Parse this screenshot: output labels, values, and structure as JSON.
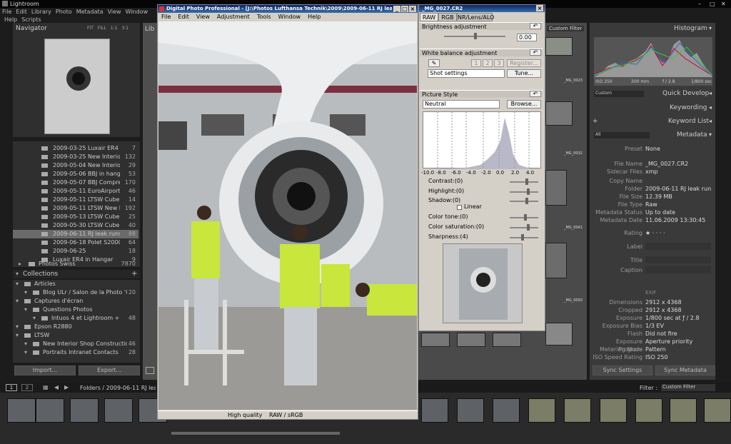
{
  "app_title": "Lightroom",
  "lr_menu": [
    "File",
    "Edit",
    "Library",
    "Photo",
    "Metadata",
    "View",
    "Window",
    "Help",
    "Scripts"
  ],
  "navigator": {
    "title": "Navigator",
    "zooms": [
      "FIT",
      "FILL",
      "1:1",
      "3:1"
    ]
  },
  "library_tab": "Lib",
  "folders": [
    {
      "name": "2009-03-25 Luxair ER4 test...",
      "count": "7"
    },
    {
      "name": "2009-03-25 New Interior S...",
      "count": "132"
    },
    {
      "name": "2009-05-04 New Interior S...",
      "count": "29"
    },
    {
      "name": "2009-05-06 BBJ in hangar",
      "count": "53"
    },
    {
      "name": "2009-05-07 BBJ Compress...",
      "count": "170"
    },
    {
      "name": "2009-05-11 EuroAirport By...",
      "count": "46"
    },
    {
      "name": "2009-05-11 LTSW Cube By ...",
      "count": "14"
    },
    {
      "name": "2009-05-11 LTSW New Inte...",
      "count": "192"
    },
    {
      "name": "2009-05-13 LTSW Cube By ...",
      "count": "25"
    },
    {
      "name": "2009-05-30 LTSW Cube By ...",
      "count": "40"
    },
    {
      "name": "2009-06-11 RJ leak runs",
      "count": "88"
    },
    {
      "name": "2009-06-18 Polet S2000 De...",
      "count": "64"
    },
    {
      "name": "2009-06-25",
      "count": "18"
    },
    {
      "name": "Luxair ER4 in Hangar",
      "count": "9"
    }
  ],
  "photos_swiss": {
    "name": "Photos Swiss",
    "count": "7870"
  },
  "collections": {
    "title": "Collections",
    "plus": "+"
  },
  "collection_items": [
    {
      "name": "Articles",
      "count": ""
    },
    {
      "name": "Blog ULr / Salon de la Photo '08",
      "count": "20"
    },
    {
      "name": "Captures d'écran",
      "count": ""
    },
    {
      "name": "Questions Photos",
      "count": ""
    },
    {
      "name": "Intuos 4 et Lightroom  +",
      "count": "48"
    },
    {
      "name": "Epson R2880",
      "count": ""
    },
    {
      "name": "LTSW",
      "count": ""
    },
    {
      "name": "New Interior Shop Construction",
      "count": "46"
    },
    {
      "name": "Portraits Intranet Contacts",
      "count": "28"
    }
  ],
  "import_label": "Import...",
  "export_label": "Export...",
  "dpp": {
    "title": "Digital Photo Professional - [J:\\Photos Lufthansa Technik\\2009\\2009-06-11 RJ leak runs\\...",
    "menu": [
      "File",
      "Edit",
      "View",
      "Adjustment",
      "Tools",
      "Window",
      "Help"
    ],
    "status_quality": "High quality",
    "status_mode": "RAW / sRGB"
  },
  "tool": {
    "title": "_MG_0027.CR2",
    "tabs": [
      "RAW",
      "RGB",
      "NR/Lens/ALO"
    ],
    "brightness_label": "Brightness adjustment",
    "brightness_value": "0.00",
    "wb_label": "White balance adjustment",
    "wb_register": "Register...",
    "wb_nums": [
      "1",
      "2",
      "3"
    ],
    "wb_select": "Shot settings",
    "wb_tune": "Tune...",
    "picture_style_label": "Picture Style",
    "picture_style_value": "Neutral",
    "browse": "Browse...",
    "hist_ticks": [
      "-10.0",
      "-8.0",
      "-6.0",
      "-4.0",
      "-2.0",
      "0.0",
      "2.0",
      "4.0"
    ],
    "contrast": "Contrast:(0)",
    "highlight": "Highlight:(0)",
    "shadow": "Shadow:(0)",
    "linear": "Linear",
    "color_tone": "Color tone:(0)",
    "color_saturation": "Color saturation:(0)",
    "sharpness": "Sharpness:(4)"
  },
  "grid_labels": [
    "_MG_0023",
    "_MG_0032",
    "_MG_0041",
    "_MG_0050"
  ],
  "custom_filter_top": "Custom Filter",
  "histogram": {
    "title": "Histogram",
    "iso": "ISO 250",
    "focal": "200 mm",
    "aperture": "f / 2.8",
    "shutter": "1/800 sec"
  },
  "quick_develop": {
    "preset_select": "Custom",
    "title": "Quick Develop"
  },
  "keywording": "Keywording",
  "keyword_list": "Keyword List",
  "metadata": {
    "select": "All",
    "title": "Metadata"
  },
  "meta_rows": [
    {
      "k": "Preset",
      "v": "None"
    },
    {
      "k": "File Name",
      "v": "_MG_0027.CR2"
    },
    {
      "k": "Sidecar Files",
      "v": "xmp"
    },
    {
      "k": "Copy Name",
      "v": ""
    },
    {
      "k": "Folder",
      "v": "2009-06-11 RJ leak runs"
    },
    {
      "k": "File Size",
      "v": "12.39 MB"
    },
    {
      "k": "File Type",
      "v": "Raw"
    },
    {
      "k": "Metadata Status",
      "v": "Up to date"
    },
    {
      "k": "Metadata Date",
      "v": "11.06.2009 13:30:45"
    },
    {
      "k": "Rating",
      "v": "★ · · · ·"
    },
    {
      "k": "Label",
      "v": ""
    },
    {
      "k": "Title",
      "v": ""
    },
    {
      "k": "Caption",
      "v": ""
    }
  ],
  "exif_label": "EXIF",
  "exif_rows": [
    {
      "k": "Dimensions",
      "v": "2912 x 4368"
    },
    {
      "k": "Cropped",
      "v": "2912 x 4368"
    },
    {
      "k": "Exposure",
      "v": "1/800 sec at ƒ / 2.8"
    },
    {
      "k": "Exposure Bias",
      "v": "1/3 EV"
    },
    {
      "k": "Flash",
      "v": "Did not fire"
    },
    {
      "k": "Exposure Program",
      "v": "Aperture priority"
    },
    {
      "k": "Metering Mode",
      "v": "Pattern"
    },
    {
      "k": "ISO Speed Rating",
      "v": "ISO 250"
    }
  ],
  "sync_settings": "Sync Settings",
  "sync_metadata": "Sync Metadata",
  "filmstrip": {
    "page1": "1",
    "page2": "2",
    "breadcrumb": "Folders / 2009-06-11 RJ leak runs",
    "filter_label": "Filter :",
    "filter_value": "Custom Filter"
  }
}
